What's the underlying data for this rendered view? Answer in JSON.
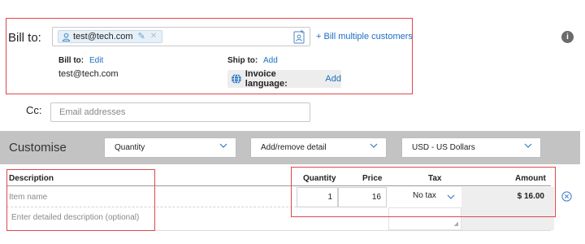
{
  "bill_to": {
    "label": "Bill to:",
    "recipient_chip": "test@tech.com",
    "bill_multiple": "+ Bill multiple customers",
    "sub_label": "Bill to:",
    "edit_link": "Edit",
    "email": "test@tech.com",
    "ship_to_label": "Ship to:",
    "ship_to_add": "Add",
    "invoice_language_label": "Invoice language:",
    "invoice_language_add": "Add"
  },
  "cc": {
    "label": "Cc:",
    "placeholder": "Email addresses"
  },
  "customise": {
    "label": "Customise",
    "quantity_select": "Quantity",
    "detail_select": "Add/remove detail",
    "currency_select": "USD - US Dollars"
  },
  "table": {
    "headers": {
      "description": "Description",
      "quantity": "Quantity",
      "price": "Price",
      "tax": "Tax",
      "amount": "Amount"
    },
    "row": {
      "item_placeholder": "Item name",
      "description_placeholder": "Enter detailed description (optional)",
      "quantity": "1",
      "price": "16",
      "tax": "No tax",
      "amount": "$ 16.00"
    }
  },
  "icons": {
    "info": "info-icon",
    "remove": "remove-circle-icon"
  },
  "colors": {
    "link": "#1d6ec0",
    "highlight_border": "#e0474c",
    "bar": "#c3c3c3"
  }
}
